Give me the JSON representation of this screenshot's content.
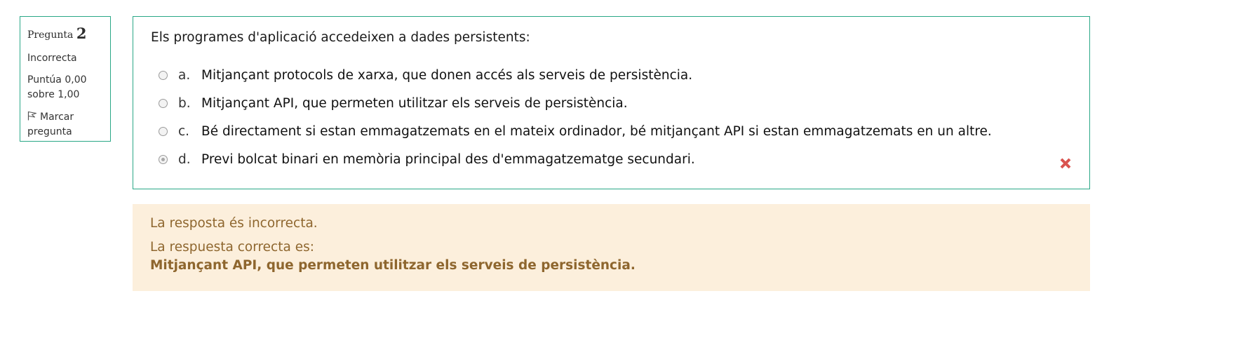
{
  "info": {
    "label": "Pregunta",
    "number": "2",
    "state": "Incorrecta",
    "grade_line1": "Puntúa 0,00",
    "grade_line2": "sobre 1,00",
    "flag_line1": "Marcar",
    "flag_line2": "pregunta"
  },
  "question": {
    "text": "Els programes d'aplicació accedeixen a dades persistents:",
    "answers": [
      {
        "letter": "a.",
        "text": "Mitjançant protocols de xarxa, que donen accés als serveis de persistència.",
        "selected": false
      },
      {
        "letter": "b.",
        "text": "Mitjançant API, que permeten utilitzar els serveis de persistència.",
        "selected": false
      },
      {
        "letter": "c.",
        "text": "Bé directament si estan emmagatzemats en el mateix ordinador, bé mitjançant API si estan emmagatzemats en un altre.",
        "selected": false
      },
      {
        "letter": "d.",
        "text": "Previ bolcat binari en memòria principal des d'emmagatzematge secundari.",
        "selected": true
      }
    ],
    "result_icon": "incorrect-x-icon"
  },
  "feedback": {
    "line1": "La resposta és incorrecta.",
    "line2": "La respuesta correcta es:",
    "correct_answer": "Mitjançant API, que permeten utilitzar els serveis de persistència."
  },
  "colors": {
    "border": "#2aa887",
    "feedback_bg": "#fcefdc",
    "feedback_text": "#8e662e",
    "incorrect": "#d9534f"
  }
}
